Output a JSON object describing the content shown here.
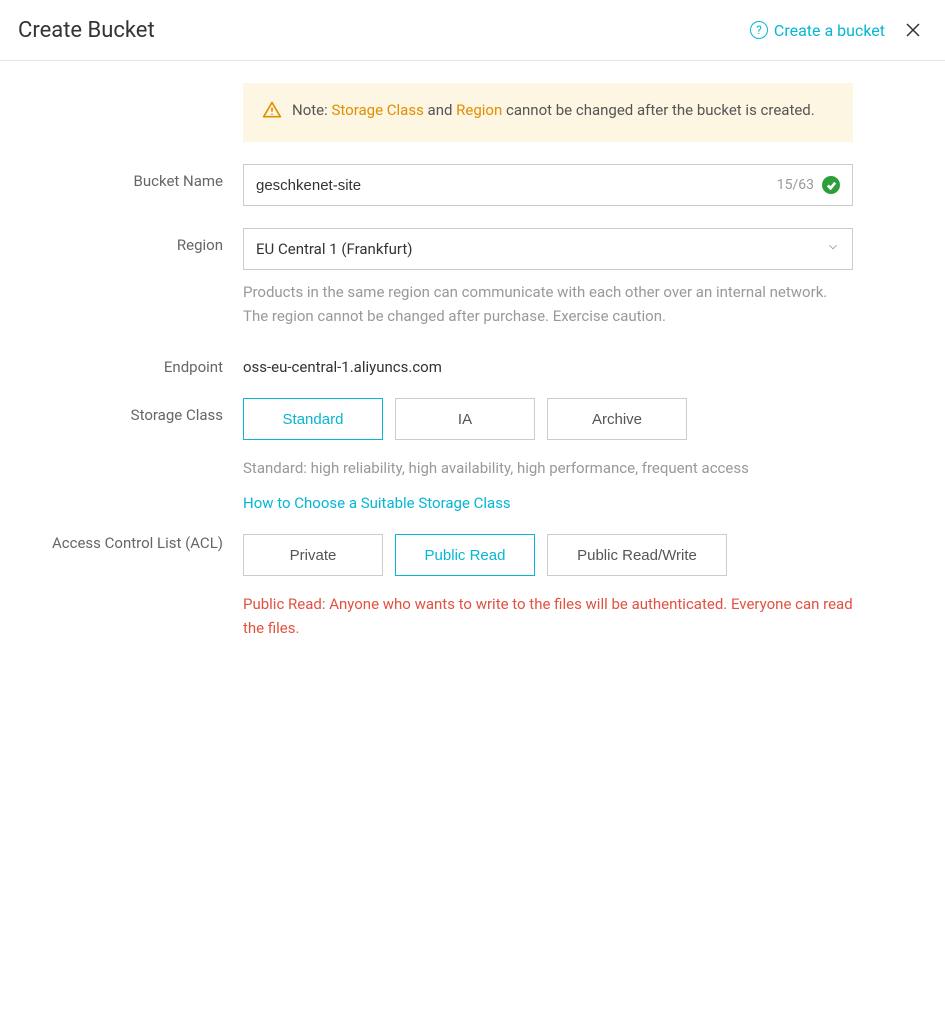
{
  "header": {
    "title": "Create Bucket",
    "help_link": "Create a bucket"
  },
  "note": {
    "prefix": "Note: ",
    "storage_class": "Storage Class",
    "and": " and ",
    "region_word": "Region",
    "suffix": " cannot be changed after the bucket is created."
  },
  "form": {
    "bucket_name": {
      "label": "Bucket Name",
      "value": "geschkenet-site",
      "counter": "15/63"
    },
    "region": {
      "label": "Region",
      "value": "EU Central 1 (Frankfurt)",
      "help": "Products in the same region can communicate with each other over an internal network. The region cannot be changed after purchase. Exercise caution."
    },
    "endpoint": {
      "label": "Endpoint",
      "value": "oss-eu-central-1.aliyuncs.com"
    },
    "storage_class": {
      "label": "Storage Class",
      "options": {
        "standard": "Standard",
        "ia": "IA",
        "archive": "Archive"
      },
      "desc": "Standard: high reliability, high availability, high performance, frequent access",
      "link": "How to Choose a Suitable Storage Class"
    },
    "acl": {
      "label": "Access Control List (ACL)",
      "options": {
        "private": "Private",
        "public_read": "Public Read",
        "public_read_write": "Public Read/Write"
      },
      "warn": "Public Read: Anyone who wants to write to the files will be authenticated. Everyone can read the files."
    }
  }
}
